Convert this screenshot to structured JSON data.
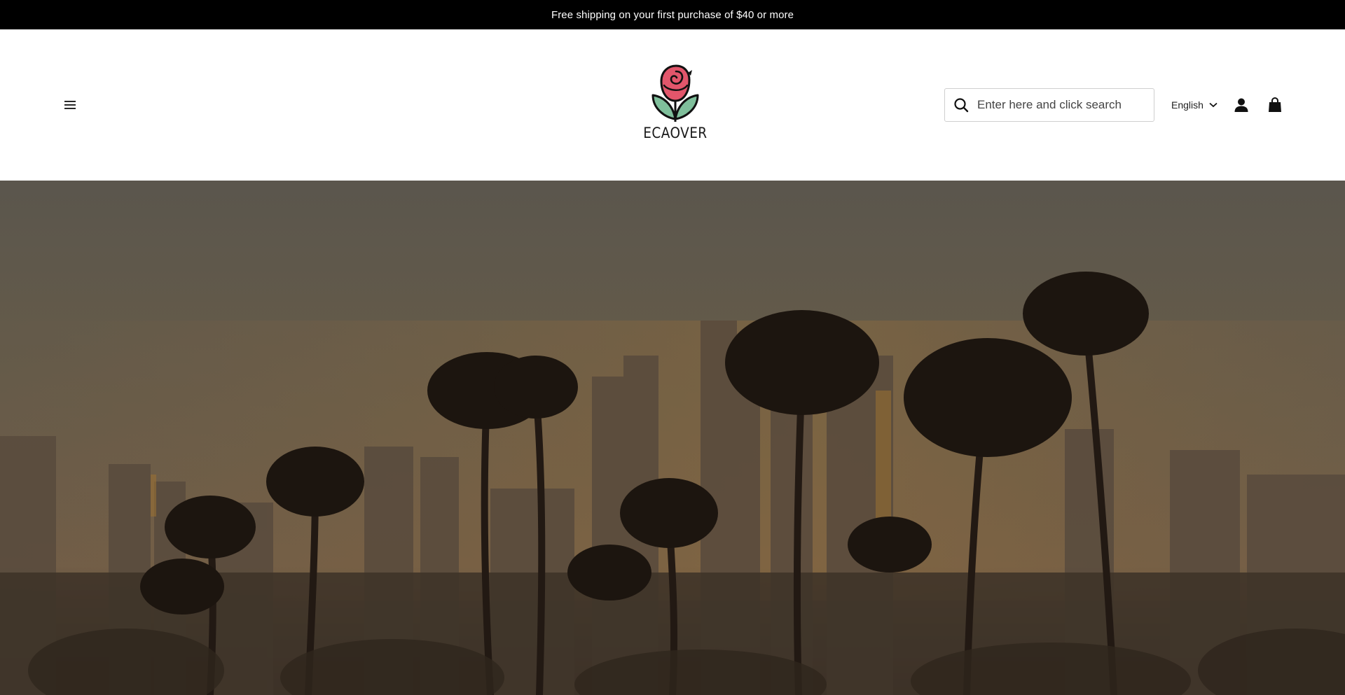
{
  "announcement": {
    "text": "Free shipping on your first purchase of $40 or more"
  },
  "header": {
    "menu_icon": "hamburger-icon",
    "logo": {
      "text": "ECAOVER",
      "icon": "rose-logo-icon",
      "colors": {
        "petal": "#e2566b",
        "leaf": "#7fbf9b",
        "outline": "#111111"
      }
    },
    "search": {
      "placeholder": "Enter here and click search",
      "value": "",
      "icon": "search-icon"
    },
    "language": {
      "selected": "English",
      "icon": "chevron-down-icon"
    },
    "account_icon": "user-icon",
    "cart_icon": "shopping-bag-icon"
  },
  "hero": {
    "image": "city-skyline-with-palm-trees-at-sunset",
    "colors": {
      "sky_top": "#6f6a5e",
      "sky_mid": "#8a7257",
      "haze": "#a27e52"
    }
  }
}
